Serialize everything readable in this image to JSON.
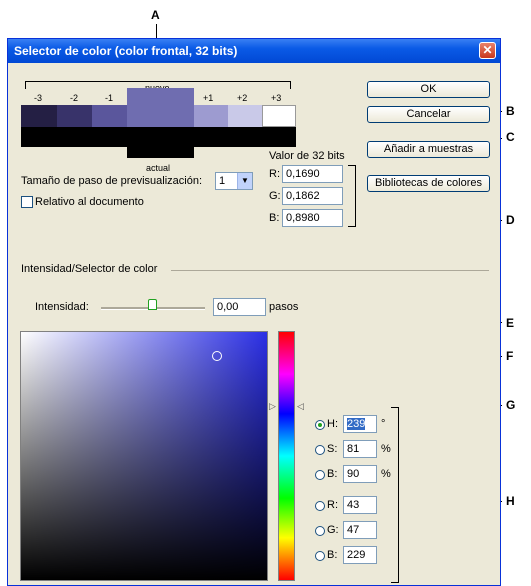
{
  "window": {
    "title": "Selector de color (color frontal, 32 bits)",
    "close_glyph": "✕"
  },
  "preview": {
    "new_label": "nuevo",
    "current_label": "actual",
    "steps": [
      "-3",
      "-2",
      "-1",
      "+1",
      "+2",
      "+3"
    ],
    "colors": [
      "#241f44",
      "#38336a",
      "#5a569c",
      "#6f6db0",
      "#9d9bd0",
      "#c9c9e8",
      "#ffffff"
    ],
    "current_color": "#000000"
  },
  "buttons": {
    "ok": "OK",
    "cancel": "Cancelar",
    "add_swatches": "Añadir a muestras",
    "libraries": "Bibliotecas de colores"
  },
  "step_size": {
    "label": "Tamaño de paso de previsualización:",
    "value": "1"
  },
  "relative_doc": {
    "label": "Relativo al documento",
    "checked": false
  },
  "bits32": {
    "heading": "Valor de 32 bits",
    "r_label": "R:",
    "r_value": "0,1690",
    "g_label": "G:",
    "g_value": "0,1862",
    "b_label": "B:",
    "b_value": "0,8980"
  },
  "section_label": "Intensidad/Selector de color",
  "intensity": {
    "label": "Intensidad:",
    "value": "0,00",
    "unit": "pasos"
  },
  "picker": {
    "h_label": "H:",
    "h_value": "239",
    "h_unit": "°",
    "s_label": "S:",
    "s_value": "81",
    "s_unit": "%",
    "bb_label": "B:",
    "bb_value": "90",
    "bb_unit": "%",
    "r_label": "R:",
    "r_value": "43",
    "g_label": "G:",
    "g_value": "47",
    "b2_label": "B:",
    "b2_value": "229",
    "selected_mode": "H"
  },
  "callouts": {
    "a": "A",
    "b": "B",
    "c": "C",
    "d": "D",
    "e": "E",
    "f": "F",
    "g": "G",
    "h": "H"
  },
  "colors": {
    "titlebar": "#0a5ae6",
    "hue_field": "#2b2fe5",
    "selection_highlight": "#316ac5"
  }
}
